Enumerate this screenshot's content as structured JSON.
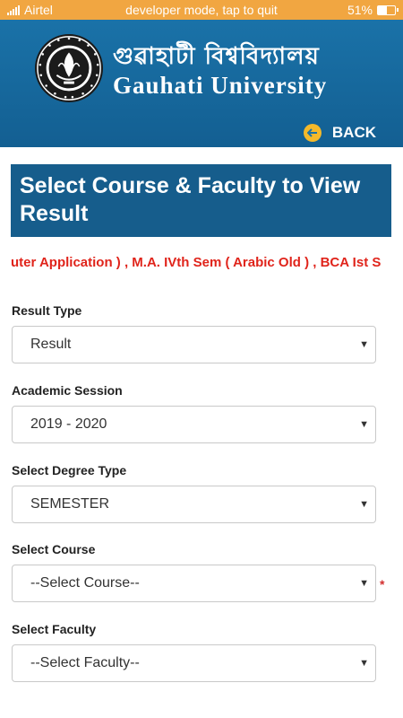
{
  "status_bar": {
    "carrier": "Airtel",
    "center_text": "developer mode, tap to quit",
    "battery": "51%",
    "battery_level": 0.51,
    "bg_color": "#f1a641"
  },
  "header": {
    "title_bengali": "গুৱাহাটী বিশ্ববিদ্যালয়",
    "title_english": "Gauhati University",
    "back_label": "BACK",
    "back_icon": "arrow-left-circle-icon",
    "bg_color": "#1a72a8"
  },
  "banner": {
    "title": "Select Course & Faculty to View Result",
    "bg_color": "#165d8c"
  },
  "ticker": {
    "text": "uter Application ) , M.A. IVth Sem ( Arabic Old ) , BCA Ist S",
    "color": "#e0241b"
  },
  "form": {
    "result_type": {
      "label": "Result Type",
      "value": "Result"
    },
    "academic_session": {
      "label": "Academic Session",
      "value": "2019 - 2020"
    },
    "degree_type": {
      "label": "Select Degree Type",
      "value": "SEMESTER"
    },
    "course": {
      "label": "Select Course",
      "value": "--Select Course--",
      "required_mark": "*"
    },
    "faculty": {
      "label": "Select Faculty",
      "value": "--Select Faculty--"
    },
    "caret": "▼"
  }
}
